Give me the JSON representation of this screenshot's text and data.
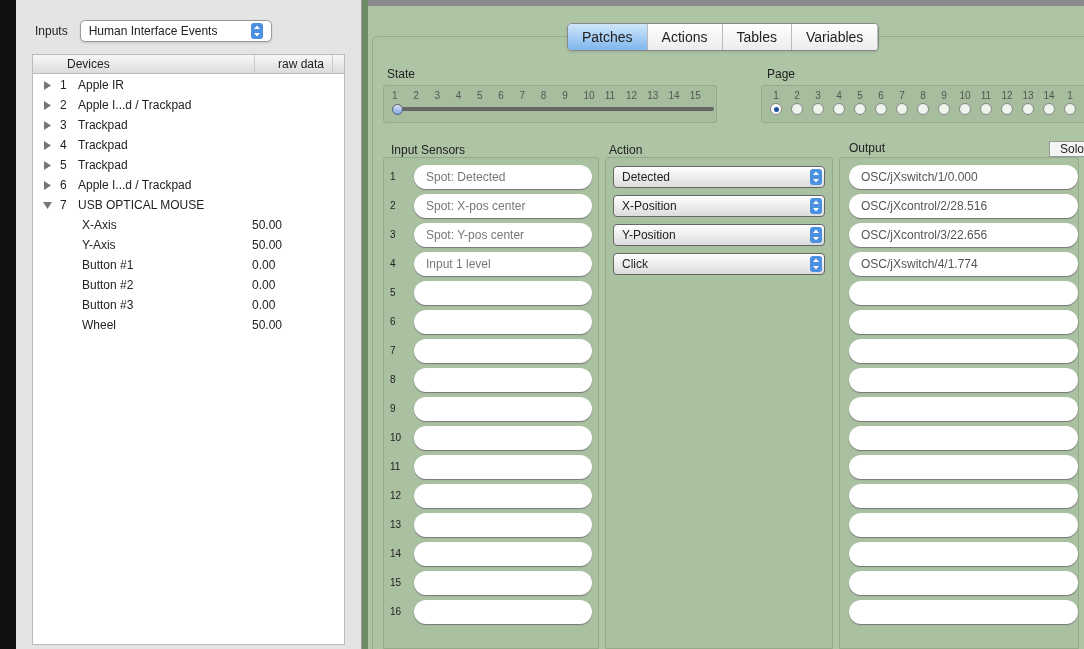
{
  "inputs": {
    "label": "Inputs",
    "value": "Human Interface Events"
  },
  "devices": {
    "columns": [
      "Devices",
      "raw data"
    ],
    "rows": [
      {
        "number": "1",
        "name": "Apple IR",
        "expanded": false
      },
      {
        "number": "2",
        "name": "Apple I...d / Trackpad",
        "expanded": false
      },
      {
        "number": "3",
        "name": "Trackpad",
        "expanded": false
      },
      {
        "number": "4",
        "name": "Trackpad",
        "expanded": false
      },
      {
        "number": "5",
        "name": "Trackpad",
        "expanded": false
      },
      {
        "number": "6",
        "name": "Apple I...d / Trackpad",
        "expanded": false
      },
      {
        "number": "7",
        "name": "USB OPTICAL MOUSE",
        "expanded": true,
        "children": [
          {
            "name": "X-Axis",
            "value": "50.00"
          },
          {
            "name": "Y-Axis",
            "value": "50.00"
          },
          {
            "name": "Button #1",
            "value": "0.00"
          },
          {
            "name": "Button #2",
            "value": "0.00"
          },
          {
            "name": "Button #3",
            "value": "0.00"
          },
          {
            "name": "Wheel",
            "value": "50.00"
          }
        ]
      }
    ]
  },
  "tabs": [
    {
      "label": "Patches",
      "selected": true
    },
    {
      "label": "Actions",
      "selected": false
    },
    {
      "label": "Tables",
      "selected": false
    },
    {
      "label": "Variables",
      "selected": false
    }
  ],
  "state": {
    "label": "State",
    "ticks": [
      "1",
      "2",
      "3",
      "4",
      "5",
      "6",
      "7",
      "8",
      "9",
      "10",
      "11",
      "12",
      "13",
      "14",
      "15"
    ],
    "level": 0
  },
  "page": {
    "label": "Page",
    "options": [
      {
        "label": "1",
        "selected": true
      },
      {
        "label": "2",
        "selected": false
      },
      {
        "label": "3",
        "selected": false
      },
      {
        "label": "4",
        "selected": false
      },
      {
        "label": "5",
        "selected": false
      },
      {
        "label": "6",
        "selected": false
      },
      {
        "label": "7",
        "selected": false
      },
      {
        "label": "8",
        "selected": false
      },
      {
        "label": "9",
        "selected": false
      },
      {
        "label": "10",
        "selected": false
      },
      {
        "label": "11",
        "selected": false
      },
      {
        "label": "12",
        "selected": false
      },
      {
        "label": "13",
        "selected": false
      },
      {
        "label": "14",
        "selected": false
      },
      {
        "label": "1",
        "selected": false
      }
    ]
  },
  "input_sensors": {
    "title": "Input Sensors",
    "rows": [
      {
        "number": "1",
        "value": "Spot: Detected"
      },
      {
        "number": "2",
        "value": "Spot: X-pos center"
      },
      {
        "number": "3",
        "value": "Spot: Y-pos center"
      },
      {
        "number": "4",
        "value": "Input 1 level"
      },
      {
        "number": "5"
      },
      {
        "number": "6"
      },
      {
        "number": "7"
      },
      {
        "number": "8"
      },
      {
        "number": "9"
      },
      {
        "number": "10"
      },
      {
        "number": "11"
      },
      {
        "number": "12"
      },
      {
        "number": "13"
      },
      {
        "number": "14"
      },
      {
        "number": "15"
      },
      {
        "number": "16"
      }
    ]
  },
  "action": {
    "title": "Action",
    "selects": [
      "Detected",
      "X-Position",
      "Y-Position",
      "Click"
    ]
  },
  "output": {
    "title": "Output",
    "solo": "Solo",
    "rows": [
      {
        "value": "OSC/jXswitch/1/0.000"
      },
      {
        "value": "OSC/jXcontrol/2/28.516"
      },
      {
        "value": "OSC/jXcontrol/3/22.656"
      },
      {
        "value": "OSC/jXswitch/4/1.774"
      },
      {},
      {},
      {},
      {},
      {},
      {},
      {},
      {},
      {},
      {},
      {},
      {}
    ]
  }
}
